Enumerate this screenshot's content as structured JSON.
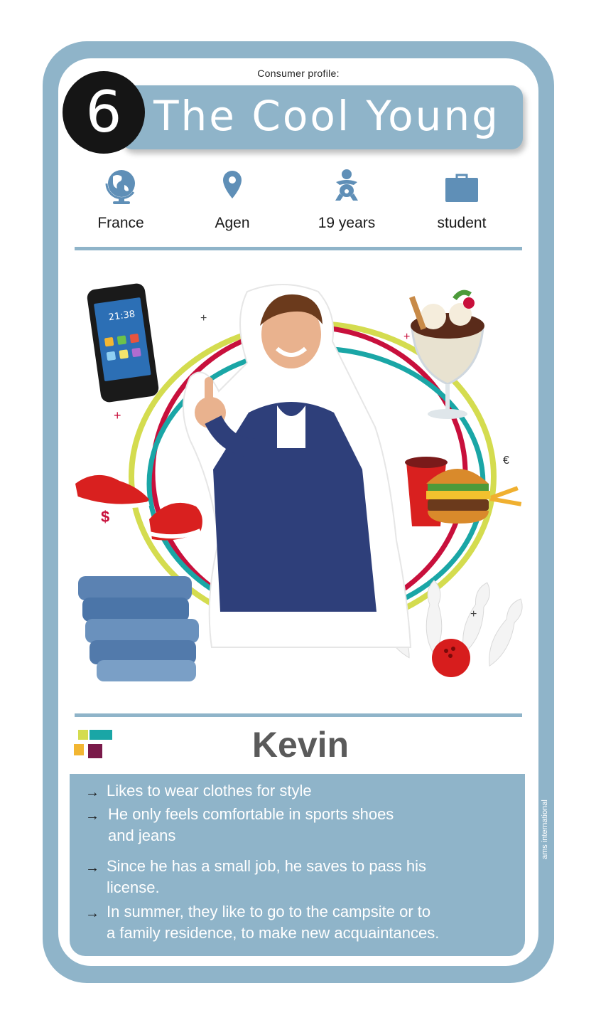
{
  "card": {
    "profile_label": "Consumer profile:",
    "number": "6",
    "title": "The Cool Young"
  },
  "info": [
    {
      "icon": "globe-icon",
      "label": "France"
    },
    {
      "icon": "location-pin-icon",
      "label": "Agen"
    },
    {
      "icon": "baby-icon",
      "label": "19 years"
    },
    {
      "icon": "briefcase-icon",
      "label": "student"
    }
  ],
  "scene": {
    "phone_time": "21:38",
    "symbols": {
      "euro": "€",
      "dollar": "$",
      "cross": "+"
    }
  },
  "person": {
    "name": "Kevin"
  },
  "bullets": [
    {
      "lines": [
        "Likes to wear clothes for style"
      ]
    },
    {
      "lines": [
        "He only feels comfortable in sports shoes",
        "and jeans"
      ]
    },
    {
      "lines": [
        "Since he has a small job, he saves to pass his",
        "license."
      ]
    },
    {
      "lines": [
        "In summer, they like to go to the campsite or to",
        "a family residence, to make new acquaintances."
      ]
    }
  ],
  "watermark": "ams international",
  "colors": {
    "card_blue": "#8fb4c9",
    "accent_red": "#c8103c",
    "accent_teal": "#1aa6a6",
    "accent_lime": "#d4dc4f",
    "icon_blue": "#5f8fb7"
  }
}
